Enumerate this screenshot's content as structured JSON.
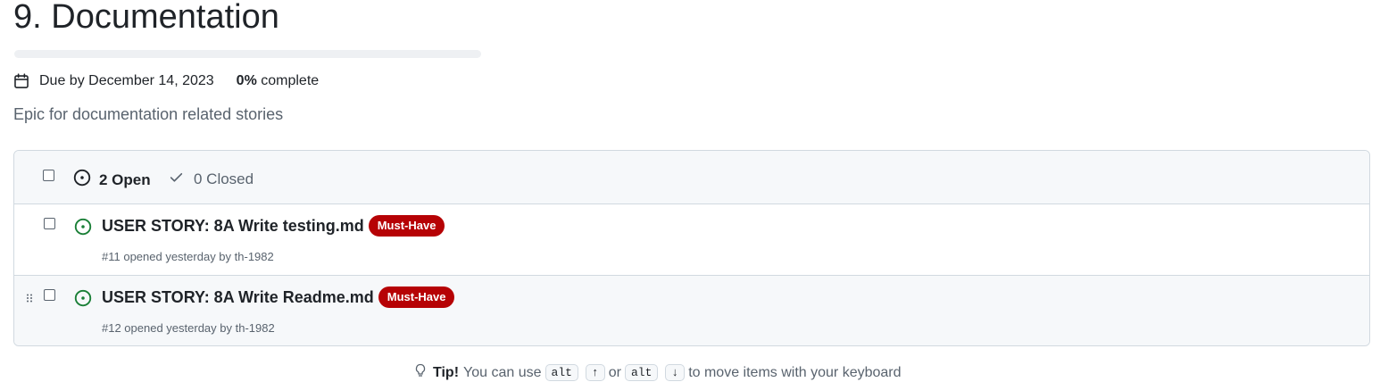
{
  "milestone": {
    "title": "9. Documentation",
    "progress_fraction": 0,
    "due_label": "Due by December 14, 2023",
    "percent_value": "0%",
    "percent_suffix": " complete",
    "description": "Epic for documentation related stories"
  },
  "issues": {
    "open_label": "2 Open",
    "closed_label": "0 Closed",
    "items": [
      {
        "title": "USER STORY: 8A Write testing.md",
        "label": "Must-Have",
        "meta": "#11 opened yesterday by th-1982"
      },
      {
        "title": "USER STORY: 8A Write Readme.md",
        "label": "Must-Have",
        "meta": "#12 opened yesterday by th-1982"
      }
    ]
  },
  "tip": {
    "prefix": "Tip!",
    "text_1": "You can use",
    "key_1": "alt",
    "key_2": "↑",
    "text_2": "or",
    "key_3": "alt",
    "key_4": "↓",
    "text_3": "to move items with your keyboard"
  },
  "colors": {
    "open_icon": "#1a7f37",
    "label_bg": "#b60205",
    "border": "#d1d9e0",
    "header_bg": "#f6f8fa"
  },
  "icons": [
    "calendar-icon",
    "issue-circle-icon",
    "check-icon",
    "open-issue-icon",
    "drag-handle-icon",
    "light-bulb-icon"
  ]
}
